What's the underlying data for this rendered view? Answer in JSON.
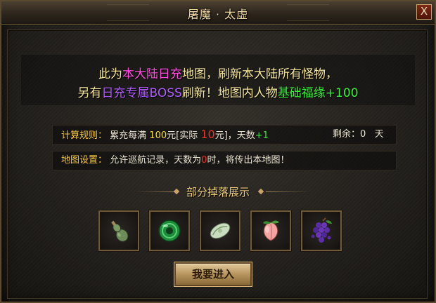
{
  "window": {
    "title": "屠魔 · 太虚",
    "close_label": "X"
  },
  "description": {
    "line1": {
      "part1": "此为",
      "highlight": "本大陆日充",
      "part2": "地图，刷新本大陆所有怪物，"
    },
    "line2": {
      "part1": "另有",
      "highlight": "日充专属BOSS",
      "part2": "刷新！地图内人物",
      "bonus": "基础福缘+100"
    }
  },
  "rules": {
    "label": "计算规则：",
    "text1": "累充每满 ",
    "amount": "100",
    "text2": "元[实际 ",
    "actual": "10",
    "text3": "元]，天数",
    "days_inc": "+1",
    "remaining_label": "剩余：",
    "remaining_value": "0",
    "remaining_unit": "天"
  },
  "settings": {
    "label": "地图设置：",
    "text1": "允许巡航记录，天数为",
    "zero": "0",
    "text2": "时，将传出本地图！"
  },
  "drops": {
    "title": "部分掉落展示",
    "items": [
      "gourd-icon",
      "jade-bead-icon",
      "jade-pendant-icon",
      "peach-icon",
      "grapes-icon"
    ]
  },
  "enter_button": "我要进入",
  "colors": {
    "magenta": "#ff4ee0",
    "purple": "#b05cff",
    "green": "#3cf03c",
    "gold": "#f5c648",
    "red": "#e8352c"
  }
}
